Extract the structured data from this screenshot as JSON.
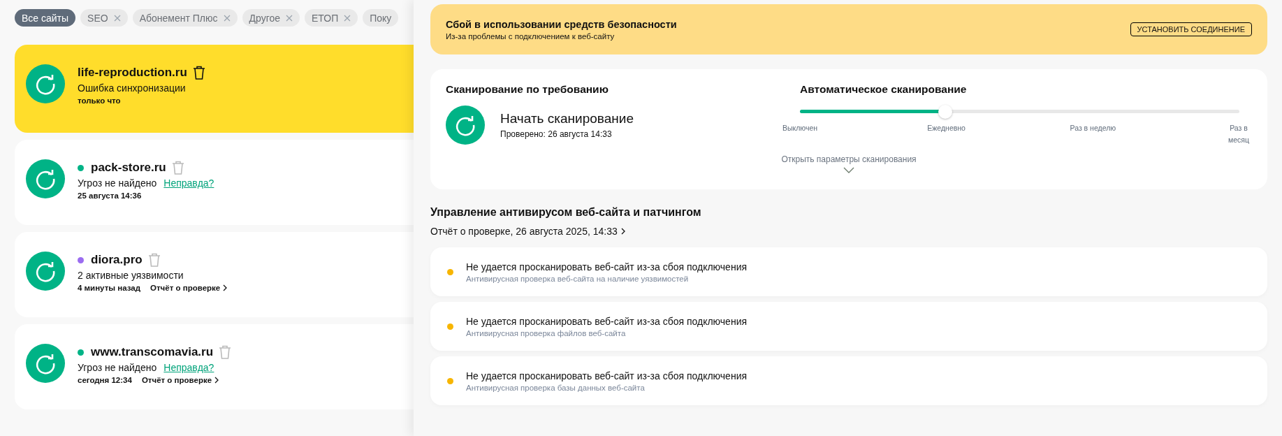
{
  "filters": [
    {
      "label": "Все сайты",
      "selected": true,
      "closable": false
    },
    {
      "label": "SEO",
      "selected": false,
      "closable": true
    },
    {
      "label": "Абонемент Плюс",
      "selected": false,
      "closable": true
    },
    {
      "label": "Другое",
      "selected": false,
      "closable": true
    },
    {
      "label": "ЕТОП",
      "selected": false,
      "closable": true
    },
    {
      "label": "Поку",
      "selected": false,
      "closable": false
    }
  ],
  "sites": [
    {
      "name": "life-reproduction.ru",
      "highlighted": true,
      "status": "Ошибка синхронизации",
      "time": "только что"
    },
    {
      "name": "pack-store.ru",
      "highlighted": false,
      "color": "#00b386",
      "status": "Угроз не найдено",
      "false_link": "Неправда?",
      "time": "25 августа 14:36"
    },
    {
      "name": "diora.pro",
      "highlighted": false,
      "color": "#9b6cf0",
      "status": "2 активные уязвимости",
      "time": "4 минуты назад",
      "report_link": "Отчёт о проверке"
    },
    {
      "name": "www.transcomavia.ru",
      "highlighted": false,
      "color": "#00b386",
      "status": "Угроз не найдено",
      "false_link": "Неправда?",
      "time": "сегодня 12:34",
      "report_link": "Отчёт о проверке"
    }
  ],
  "alert": {
    "title": "Сбой в использовании средств безопасности",
    "subtitle": "Из-за проблемы с подключением к веб-сайту",
    "button": "УСТАНОВИТЬ СОЕДИНЕНИЕ"
  },
  "on_demand": {
    "title": "Сканирование по требованию",
    "action": "Начать сканирование",
    "checked": "Проверено: 26 августа 14:33"
  },
  "auto_scan": {
    "title": "Автоматическое сканирование",
    "level": 0.33,
    "stops": [
      "Выключен",
      "Ежедневно",
      "Раз в неделю",
      "Раз в месяц"
    ],
    "more": "Открыть параметры сканирования"
  },
  "antivirus": {
    "title": "Управление антивирусом веб-сайта и патчингом",
    "report_link": "Отчёт о проверке, 26 августа 2025, 14:33",
    "issues": [
      {
        "title": "Не удается просканировать веб-сайт из-за сбоя подключения",
        "subtitle": "Антивирусная проверка веб-сайта на наличие уязвимостей",
        "color": "#f7b500"
      },
      {
        "title": "Не удается просканировать веб-сайт из-за сбоя подключения",
        "subtitle": "Антивирусная проверка файлов веб-сайта",
        "color": "#f7b500"
      },
      {
        "title": "Не удается просканировать веб-сайт из-за сбоя подключения",
        "subtitle": "Антивирусная проверка базы данных веб-сайта",
        "color": "#f7b500"
      }
    ]
  }
}
